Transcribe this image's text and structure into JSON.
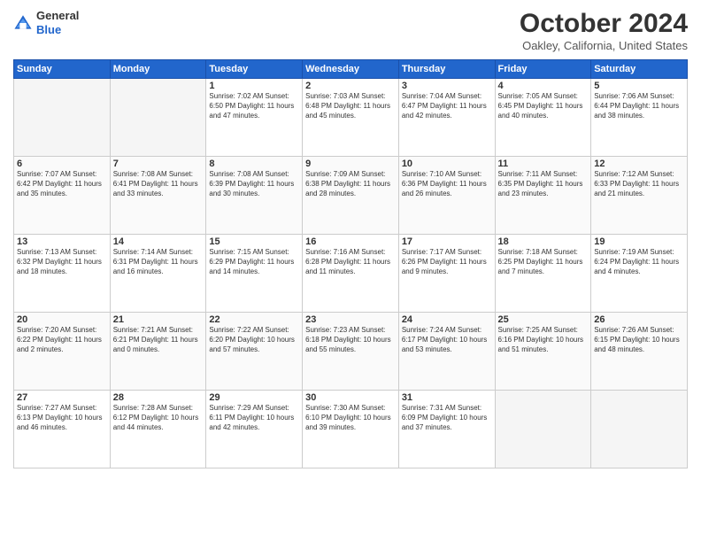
{
  "header": {
    "logo": {
      "general": "General",
      "blue": "Blue"
    },
    "month": "October 2024",
    "location": "Oakley, California, United States"
  },
  "days_of_week": [
    "Sunday",
    "Monday",
    "Tuesday",
    "Wednesday",
    "Thursday",
    "Friday",
    "Saturday"
  ],
  "weeks": [
    [
      {
        "day": "",
        "content": ""
      },
      {
        "day": "",
        "content": ""
      },
      {
        "day": "1",
        "content": "Sunrise: 7:02 AM\nSunset: 6:50 PM\nDaylight: 11 hours and 47 minutes."
      },
      {
        "day": "2",
        "content": "Sunrise: 7:03 AM\nSunset: 6:48 PM\nDaylight: 11 hours and 45 minutes."
      },
      {
        "day": "3",
        "content": "Sunrise: 7:04 AM\nSunset: 6:47 PM\nDaylight: 11 hours and 42 minutes."
      },
      {
        "day": "4",
        "content": "Sunrise: 7:05 AM\nSunset: 6:45 PM\nDaylight: 11 hours and 40 minutes."
      },
      {
        "day": "5",
        "content": "Sunrise: 7:06 AM\nSunset: 6:44 PM\nDaylight: 11 hours and 38 minutes."
      }
    ],
    [
      {
        "day": "6",
        "content": "Sunrise: 7:07 AM\nSunset: 6:42 PM\nDaylight: 11 hours and 35 minutes."
      },
      {
        "day": "7",
        "content": "Sunrise: 7:08 AM\nSunset: 6:41 PM\nDaylight: 11 hours and 33 minutes."
      },
      {
        "day": "8",
        "content": "Sunrise: 7:08 AM\nSunset: 6:39 PM\nDaylight: 11 hours and 30 minutes."
      },
      {
        "day": "9",
        "content": "Sunrise: 7:09 AM\nSunset: 6:38 PM\nDaylight: 11 hours and 28 minutes."
      },
      {
        "day": "10",
        "content": "Sunrise: 7:10 AM\nSunset: 6:36 PM\nDaylight: 11 hours and 26 minutes."
      },
      {
        "day": "11",
        "content": "Sunrise: 7:11 AM\nSunset: 6:35 PM\nDaylight: 11 hours and 23 minutes."
      },
      {
        "day": "12",
        "content": "Sunrise: 7:12 AM\nSunset: 6:33 PM\nDaylight: 11 hours and 21 minutes."
      }
    ],
    [
      {
        "day": "13",
        "content": "Sunrise: 7:13 AM\nSunset: 6:32 PM\nDaylight: 11 hours and 18 minutes."
      },
      {
        "day": "14",
        "content": "Sunrise: 7:14 AM\nSunset: 6:31 PM\nDaylight: 11 hours and 16 minutes."
      },
      {
        "day": "15",
        "content": "Sunrise: 7:15 AM\nSunset: 6:29 PM\nDaylight: 11 hours and 14 minutes."
      },
      {
        "day": "16",
        "content": "Sunrise: 7:16 AM\nSunset: 6:28 PM\nDaylight: 11 hours and 11 minutes."
      },
      {
        "day": "17",
        "content": "Sunrise: 7:17 AM\nSunset: 6:26 PM\nDaylight: 11 hours and 9 minutes."
      },
      {
        "day": "18",
        "content": "Sunrise: 7:18 AM\nSunset: 6:25 PM\nDaylight: 11 hours and 7 minutes."
      },
      {
        "day": "19",
        "content": "Sunrise: 7:19 AM\nSunset: 6:24 PM\nDaylight: 11 hours and 4 minutes."
      }
    ],
    [
      {
        "day": "20",
        "content": "Sunrise: 7:20 AM\nSunset: 6:22 PM\nDaylight: 11 hours and 2 minutes."
      },
      {
        "day": "21",
        "content": "Sunrise: 7:21 AM\nSunset: 6:21 PM\nDaylight: 11 hours and 0 minutes."
      },
      {
        "day": "22",
        "content": "Sunrise: 7:22 AM\nSunset: 6:20 PM\nDaylight: 10 hours and 57 minutes."
      },
      {
        "day": "23",
        "content": "Sunrise: 7:23 AM\nSunset: 6:18 PM\nDaylight: 10 hours and 55 minutes."
      },
      {
        "day": "24",
        "content": "Sunrise: 7:24 AM\nSunset: 6:17 PM\nDaylight: 10 hours and 53 minutes."
      },
      {
        "day": "25",
        "content": "Sunrise: 7:25 AM\nSunset: 6:16 PM\nDaylight: 10 hours and 51 minutes."
      },
      {
        "day": "26",
        "content": "Sunrise: 7:26 AM\nSunset: 6:15 PM\nDaylight: 10 hours and 48 minutes."
      }
    ],
    [
      {
        "day": "27",
        "content": "Sunrise: 7:27 AM\nSunset: 6:13 PM\nDaylight: 10 hours and 46 minutes."
      },
      {
        "day": "28",
        "content": "Sunrise: 7:28 AM\nSunset: 6:12 PM\nDaylight: 10 hours and 44 minutes."
      },
      {
        "day": "29",
        "content": "Sunrise: 7:29 AM\nSunset: 6:11 PM\nDaylight: 10 hours and 42 minutes."
      },
      {
        "day": "30",
        "content": "Sunrise: 7:30 AM\nSunset: 6:10 PM\nDaylight: 10 hours and 39 minutes."
      },
      {
        "day": "31",
        "content": "Sunrise: 7:31 AM\nSunset: 6:09 PM\nDaylight: 10 hours and 37 minutes."
      },
      {
        "day": "",
        "content": ""
      },
      {
        "day": "",
        "content": ""
      }
    ]
  ]
}
